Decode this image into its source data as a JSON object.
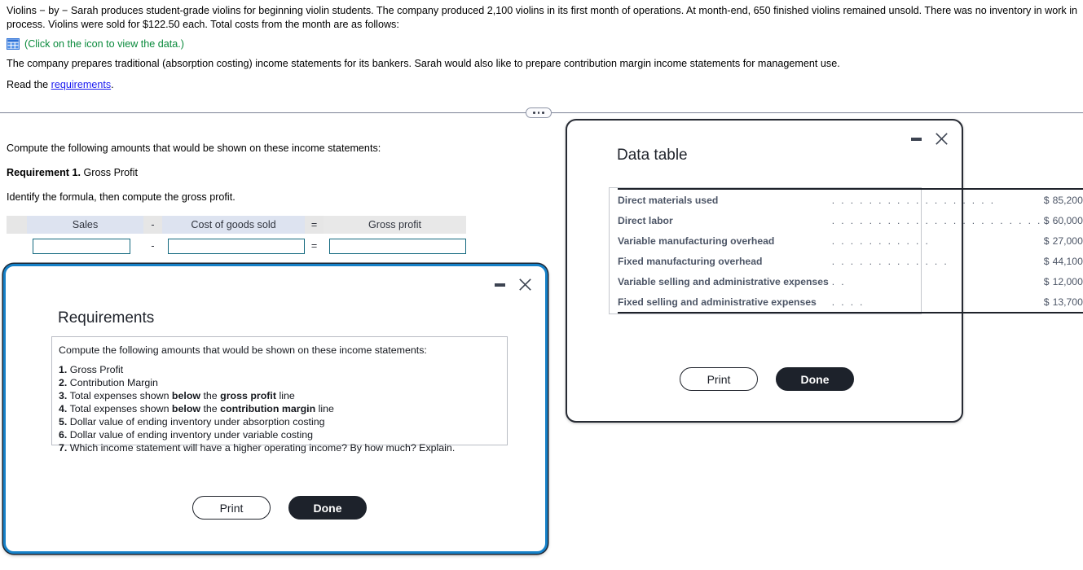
{
  "problem": {
    "paragraph1": "Violins − by − Sarah produces student-grade violins for beginning violin students. The company produced 2,100 violins in its first month of operations. At month-end, 650 finished violins remained unsold. There was no inventory in work in process. Violins were sold for $122.50 each. Total costs from the month are as follows:",
    "data_icon": "table-grid-icon",
    "icon_note": "(Click on the icon to view the data.)",
    "paragraph2": "The company prepares traditional (absorption costing) income statements for its bankers. Sarah would also like to prepare contribution margin income statements for management use.",
    "read_prefix": "Read the ",
    "read_link": "requirements",
    "read_suffix": "."
  },
  "divider": {
    "icon": "ellipsis-icon"
  },
  "worksheet": {
    "instruction": "Compute the following amounts that would be shown on these income statements:",
    "requirement_label": "Requirement 1.",
    "requirement_title": " Gross Profit",
    "formula_prompt": "Identify the formula, then compute the gross profit.",
    "formula": {
      "headers": {
        "term1": "Sales",
        "op1": "-",
        "term2": "Cost of goods sold",
        "op2": "=",
        "result": "Gross profit"
      },
      "row_ops": {
        "op1": "-",
        "op2": "="
      },
      "values": {
        "term1": "",
        "term2": "",
        "result": ""
      },
      "placeholders": {
        "term1": "",
        "term2": "",
        "result": ""
      }
    }
  },
  "requirements_modal": {
    "title": "Requirements",
    "minimize_icon": "minimize-icon",
    "close_icon": "close-icon",
    "intro": "Compute the following amounts that would be shown on these income statements:",
    "items": [
      {
        "num": "1.",
        "text": "Gross Profit"
      },
      {
        "num": "2.",
        "text": "Contribution Margin"
      },
      {
        "num": "3.",
        "text": "Total expenses shown below the gross profit line"
      },
      {
        "num": "4.",
        "text": "Total expenses shown below the contribution margin line"
      },
      {
        "num": "5.",
        "text": "Dollar value of ending inventory under absorption costing"
      },
      {
        "num": "6.",
        "text": "Dollar value of ending inventory under variable costing"
      },
      {
        "num": "7.",
        "text": "Which income statement will have a higher operating income? By how much? Explain."
      }
    ],
    "print_label": "Print",
    "done_label": "Done"
  },
  "datatable_modal": {
    "title": "Data table",
    "minimize_icon": "minimize-icon",
    "close_icon": "close-icon",
    "rows": [
      {
        "label": "Direct materials used",
        "leader": ". . . . . . . . . . . . . . . . . .",
        "currency": "$",
        "value": "85,200"
      },
      {
        "label": "Direct labor",
        "leader": ". . . . . . . . . . . . . . . . . . . . . . .",
        "currency": "$",
        "value": "60,000"
      },
      {
        "label": "Variable manufacturing overhead",
        "leader": ". . . . . . . . . . .",
        "currency": "$",
        "value": "27,000"
      },
      {
        "label": "Fixed manufacturing overhead",
        "leader": ". . . . . . . . . . . . .",
        "currency": "$",
        "value": "44,100"
      },
      {
        "label": "Variable selling and administrative expenses",
        "leader": ". .",
        "currency": "$",
        "value": "12,000"
      },
      {
        "label": "Fixed selling and administrative expenses",
        "leader": ". . . .",
        "currency": "$",
        "value": "13,700"
      }
    ],
    "print_label": "Print",
    "done_label": "Done"
  },
  "colors": {
    "link_blue": "#1a1af0",
    "note_green": "#0a8a3c",
    "icon_blue": "#2a6fd6",
    "input_border": "#14697f",
    "header_term_bg": "#dde3f0",
    "header_op_bg": "#e6e6e6",
    "header_result_bg": "#e8e8e8",
    "modal_focus_border": "#1681c8",
    "button_solid_bg": "#1d222b",
    "table_text": "#4c5566"
  }
}
